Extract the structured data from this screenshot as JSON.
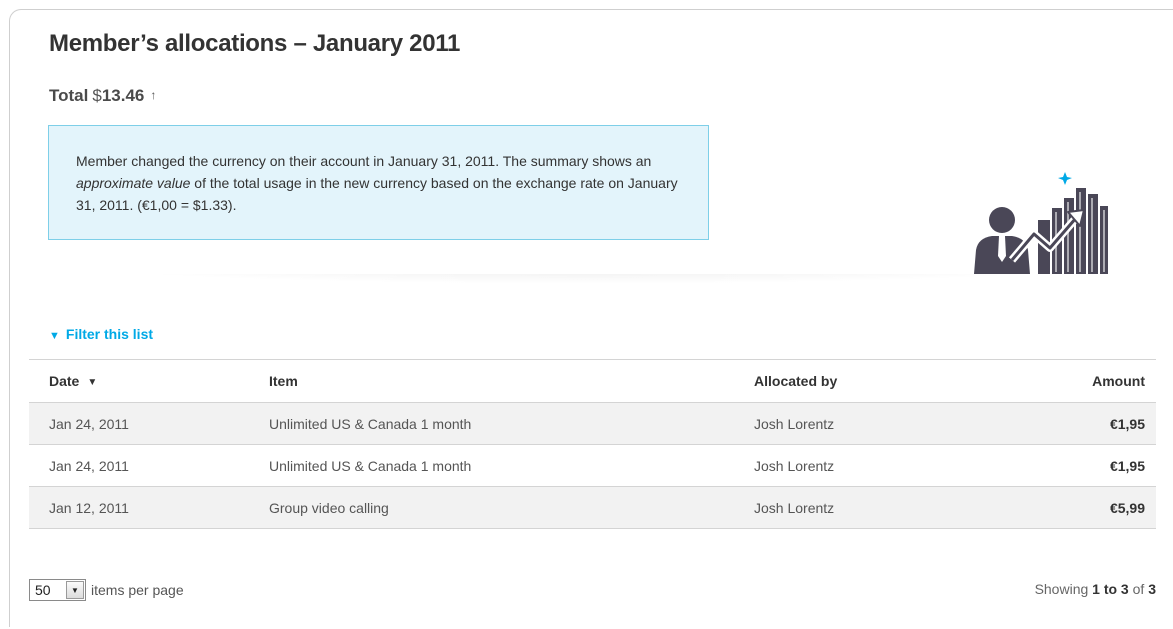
{
  "page": {
    "title": "Member’s allocations – January 2011",
    "total_label": "Total",
    "total_currency": "$",
    "total_value": "13.46",
    "total_arrow": "↑"
  },
  "notice": {
    "text_before": "Member changed the currency on their account in January 31, 2011. The summary shows an ",
    "text_em": "approximate value",
    "text_after": " of the total usage in the new currency based on the exchange rate on January 31, 2011. (€1,00 = $1.33)."
  },
  "filter": {
    "label": "Filter this list",
    "icon": "chevron-down-icon"
  },
  "table": {
    "headers": {
      "date": "Date",
      "item": "Item",
      "allocated_by": "Allocated by",
      "amount": "Amount"
    },
    "sort_icon": "sort-down-icon",
    "rows": [
      {
        "date": "Jan 24, 2011",
        "item": "Unlimited US & Canada 1 month",
        "allocated_by": "Josh Lorentz",
        "amount": "€1,95"
      },
      {
        "date": "Jan 24, 2011",
        "item": "Unlimited US & Canada 1 month",
        "allocated_by": "Josh Lorentz",
        "amount": "€1,95"
      },
      {
        "date": "Jan 12, 2011",
        "item": "Group video calling",
        "allocated_by": "Josh Lorentz",
        "amount": "€5,99"
      }
    ]
  },
  "pager": {
    "per_page_value": "50",
    "per_page_label": "items per page",
    "showing_prefix": "Showing",
    "showing_range": "1 to 3",
    "showing_of": "of",
    "showing_total": "3"
  },
  "colors": {
    "accent": "#00a9e6",
    "notice_bg": "#e3f4fb",
    "notice_border": "#7ecfe8",
    "row_alt": "#f2f2f2",
    "illustration": "#4a4757"
  }
}
